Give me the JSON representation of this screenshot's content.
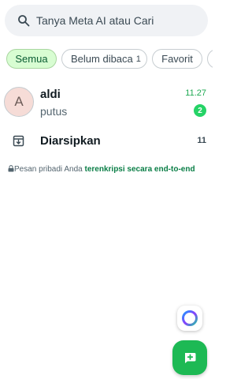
{
  "search": {
    "placeholder": "Tanya Meta AI atau Cari",
    "icon": "search-icon"
  },
  "filters": [
    {
      "label": "Semua",
      "active": true
    },
    {
      "label": "Belum dibaca",
      "count": "1"
    },
    {
      "label": "Favorit"
    },
    {
      "label": ""
    }
  ],
  "chats": [
    {
      "initial": "A",
      "name": "aldi",
      "message": "putus",
      "time": "11.27",
      "unread": "2"
    }
  ],
  "archived": {
    "label": "Diarsipkan",
    "count": "11",
    "icon": "archive-icon"
  },
  "encryption": {
    "text": "Pesan pribadi Anda ",
    "link": "terenkripsi secara end-to-end"
  },
  "actions": {
    "meta_ai_icon": "meta-ai-icon",
    "new_chat_icon": "new-chat-icon"
  },
  "colors": {
    "accent": "#25d366",
    "chip_active_bg": "#d8fdd2",
    "link": "#0a7e46",
    "fab": "#1db954"
  }
}
